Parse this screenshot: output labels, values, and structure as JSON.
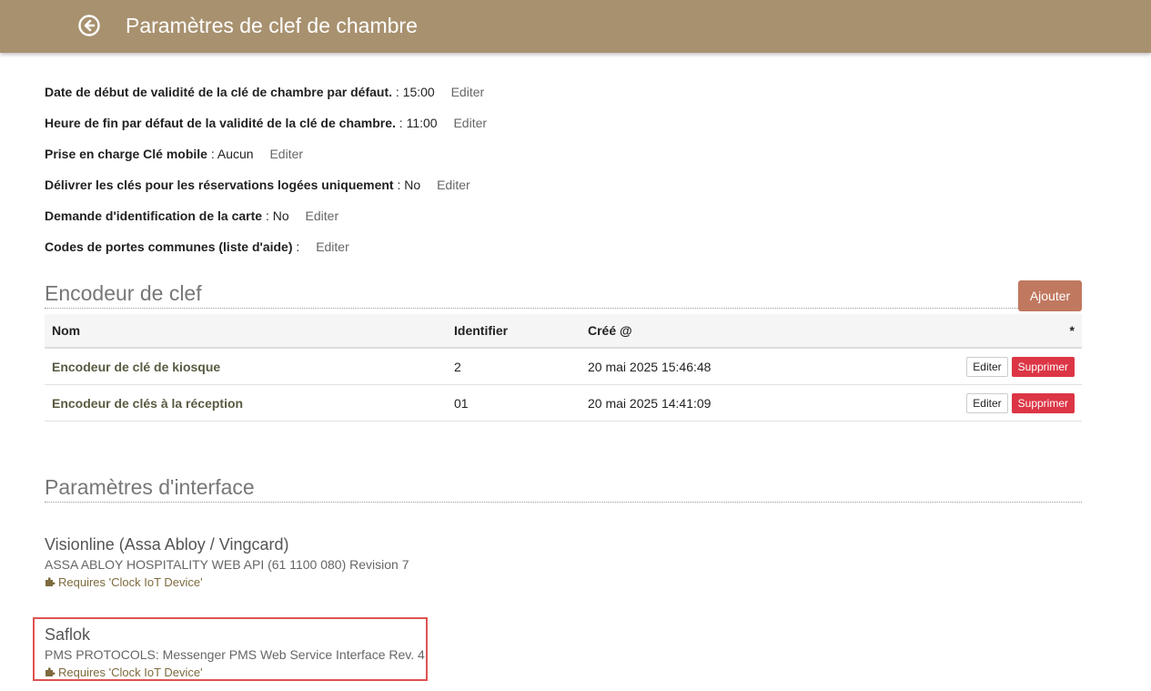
{
  "header": {
    "title": "Paramètres de clef de chambre",
    "back_icon": "circle-arrow-left-icon",
    "background": "#a8916f"
  },
  "settings": [
    {
      "label": "Date de début de validité de la clé de chambre par défaut.",
      "value": " : 15:00",
      "edit": "Editer"
    },
    {
      "label": "Heure de fin par défaut de la validité de la clé de chambre.",
      "value": " : 11:00",
      "edit": "Editer"
    },
    {
      "label": "Prise en charge Clé mobile",
      "value": " : Aucun",
      "edit": "Editer"
    },
    {
      "label": "Délivrer les clés pour les réservations logées uniquement",
      "value": " : No",
      "edit": "Editer"
    },
    {
      "label": "Demande d'identification de la carte",
      "value": " : No",
      "edit": "Editer"
    },
    {
      "label": "Codes de portes communes (liste d'aide)",
      "value": " :",
      "edit": "Editer"
    }
  ],
  "encoder": {
    "title": "Encodeur de clef",
    "add_label": "Ajouter",
    "add_color": "#c0785f",
    "columns": [
      "Nom",
      "Identifier",
      "Créé @",
      "*"
    ],
    "rows": [
      {
        "name": "Encodeur de clé de kiosque",
        "identifier": "2",
        "created": "20 mai 2025 15:46:48",
        "edit": "Editer",
        "delete": "Supprimer"
      },
      {
        "name": "Encodeur de clés à la réception",
        "identifier": "01",
        "created": "20 mai 2025 14:41:09",
        "edit": "Editer",
        "delete": "Supprimer"
      }
    ],
    "delete_color": "#dc3545"
  },
  "interfaces": {
    "title": "Paramètres d'interface",
    "items": [
      {
        "name": "Visionline (Assa Abloy / Vingcard)",
        "description": "ASSA ABLOY HOSPITALITY WEB API (61 1100 080) Revision 7",
        "requirement": "Requires 'Clock IoT Device'",
        "requirement_icon": "puzzle-icon"
      },
      {
        "name": "Saflok",
        "description": "PMS PROTOCOLS: Messenger PMS Web Service Interface Rev. 4",
        "requirement": "Requires 'Clock IoT Device'",
        "requirement_icon": "puzzle-icon",
        "highlighted": true
      }
    ],
    "highlight_color": "#e05252"
  }
}
